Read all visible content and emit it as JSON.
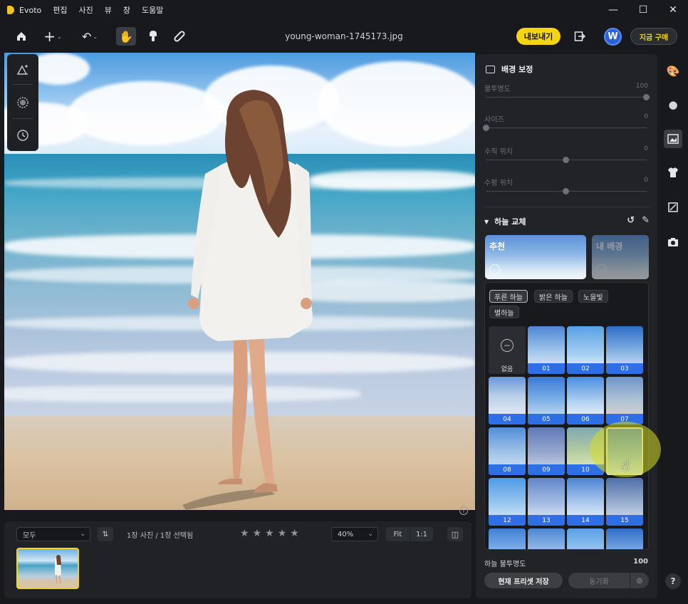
{
  "app": {
    "name": "Evoto"
  },
  "menu": [
    "편집",
    "사진",
    "뷰",
    "창",
    "도움말"
  ],
  "toolbar": {
    "filename": "young-woman-1745173.jpg",
    "export_label": "내보내기",
    "avatar_letter": "W",
    "buy_label": "지금 구매"
  },
  "panel": {
    "title": "배경 보정",
    "sliders": [
      {
        "label": "불투명도",
        "value": "100",
        "pos": 1.0
      },
      {
        "label": "사이즈",
        "value": "0",
        "pos": 0.0
      },
      {
        "label": "수직 위치",
        "value": "0",
        "pos": 0.5
      },
      {
        "label": "수평 위치",
        "value": "0",
        "pos": 0.5
      }
    ],
    "sky_section": {
      "title": "하늘 교체",
      "recommend_label": "추천",
      "my_bg_label": "내 배경",
      "chips": [
        "푸른 하늘",
        "밝은 하늘",
        "노을빛",
        "별하늘"
      ],
      "none_label": "없음",
      "tiles": [
        "01",
        "02",
        "03",
        "04",
        "05",
        "06",
        "07",
        "08",
        "09",
        "10",
        "11",
        "12",
        "13",
        "14",
        "15"
      ],
      "selected": "11"
    },
    "opacity_label": "하늘 불투명도",
    "opacity_value": "100",
    "save_preset_label": "현재 프리셋 저장",
    "sync_label": "동기화"
  },
  "bottom": {
    "filter_value": "모두",
    "count_text": "1장 사진 / 1장 선택됨",
    "rating": 0,
    "zoom_value": "40%",
    "fit_label": "Fit",
    "one_label": "1:1"
  },
  "watermark": "EVOTO",
  "colors": {
    "accent": "#f5d414",
    "tile_label": "#2e6fe6"
  }
}
